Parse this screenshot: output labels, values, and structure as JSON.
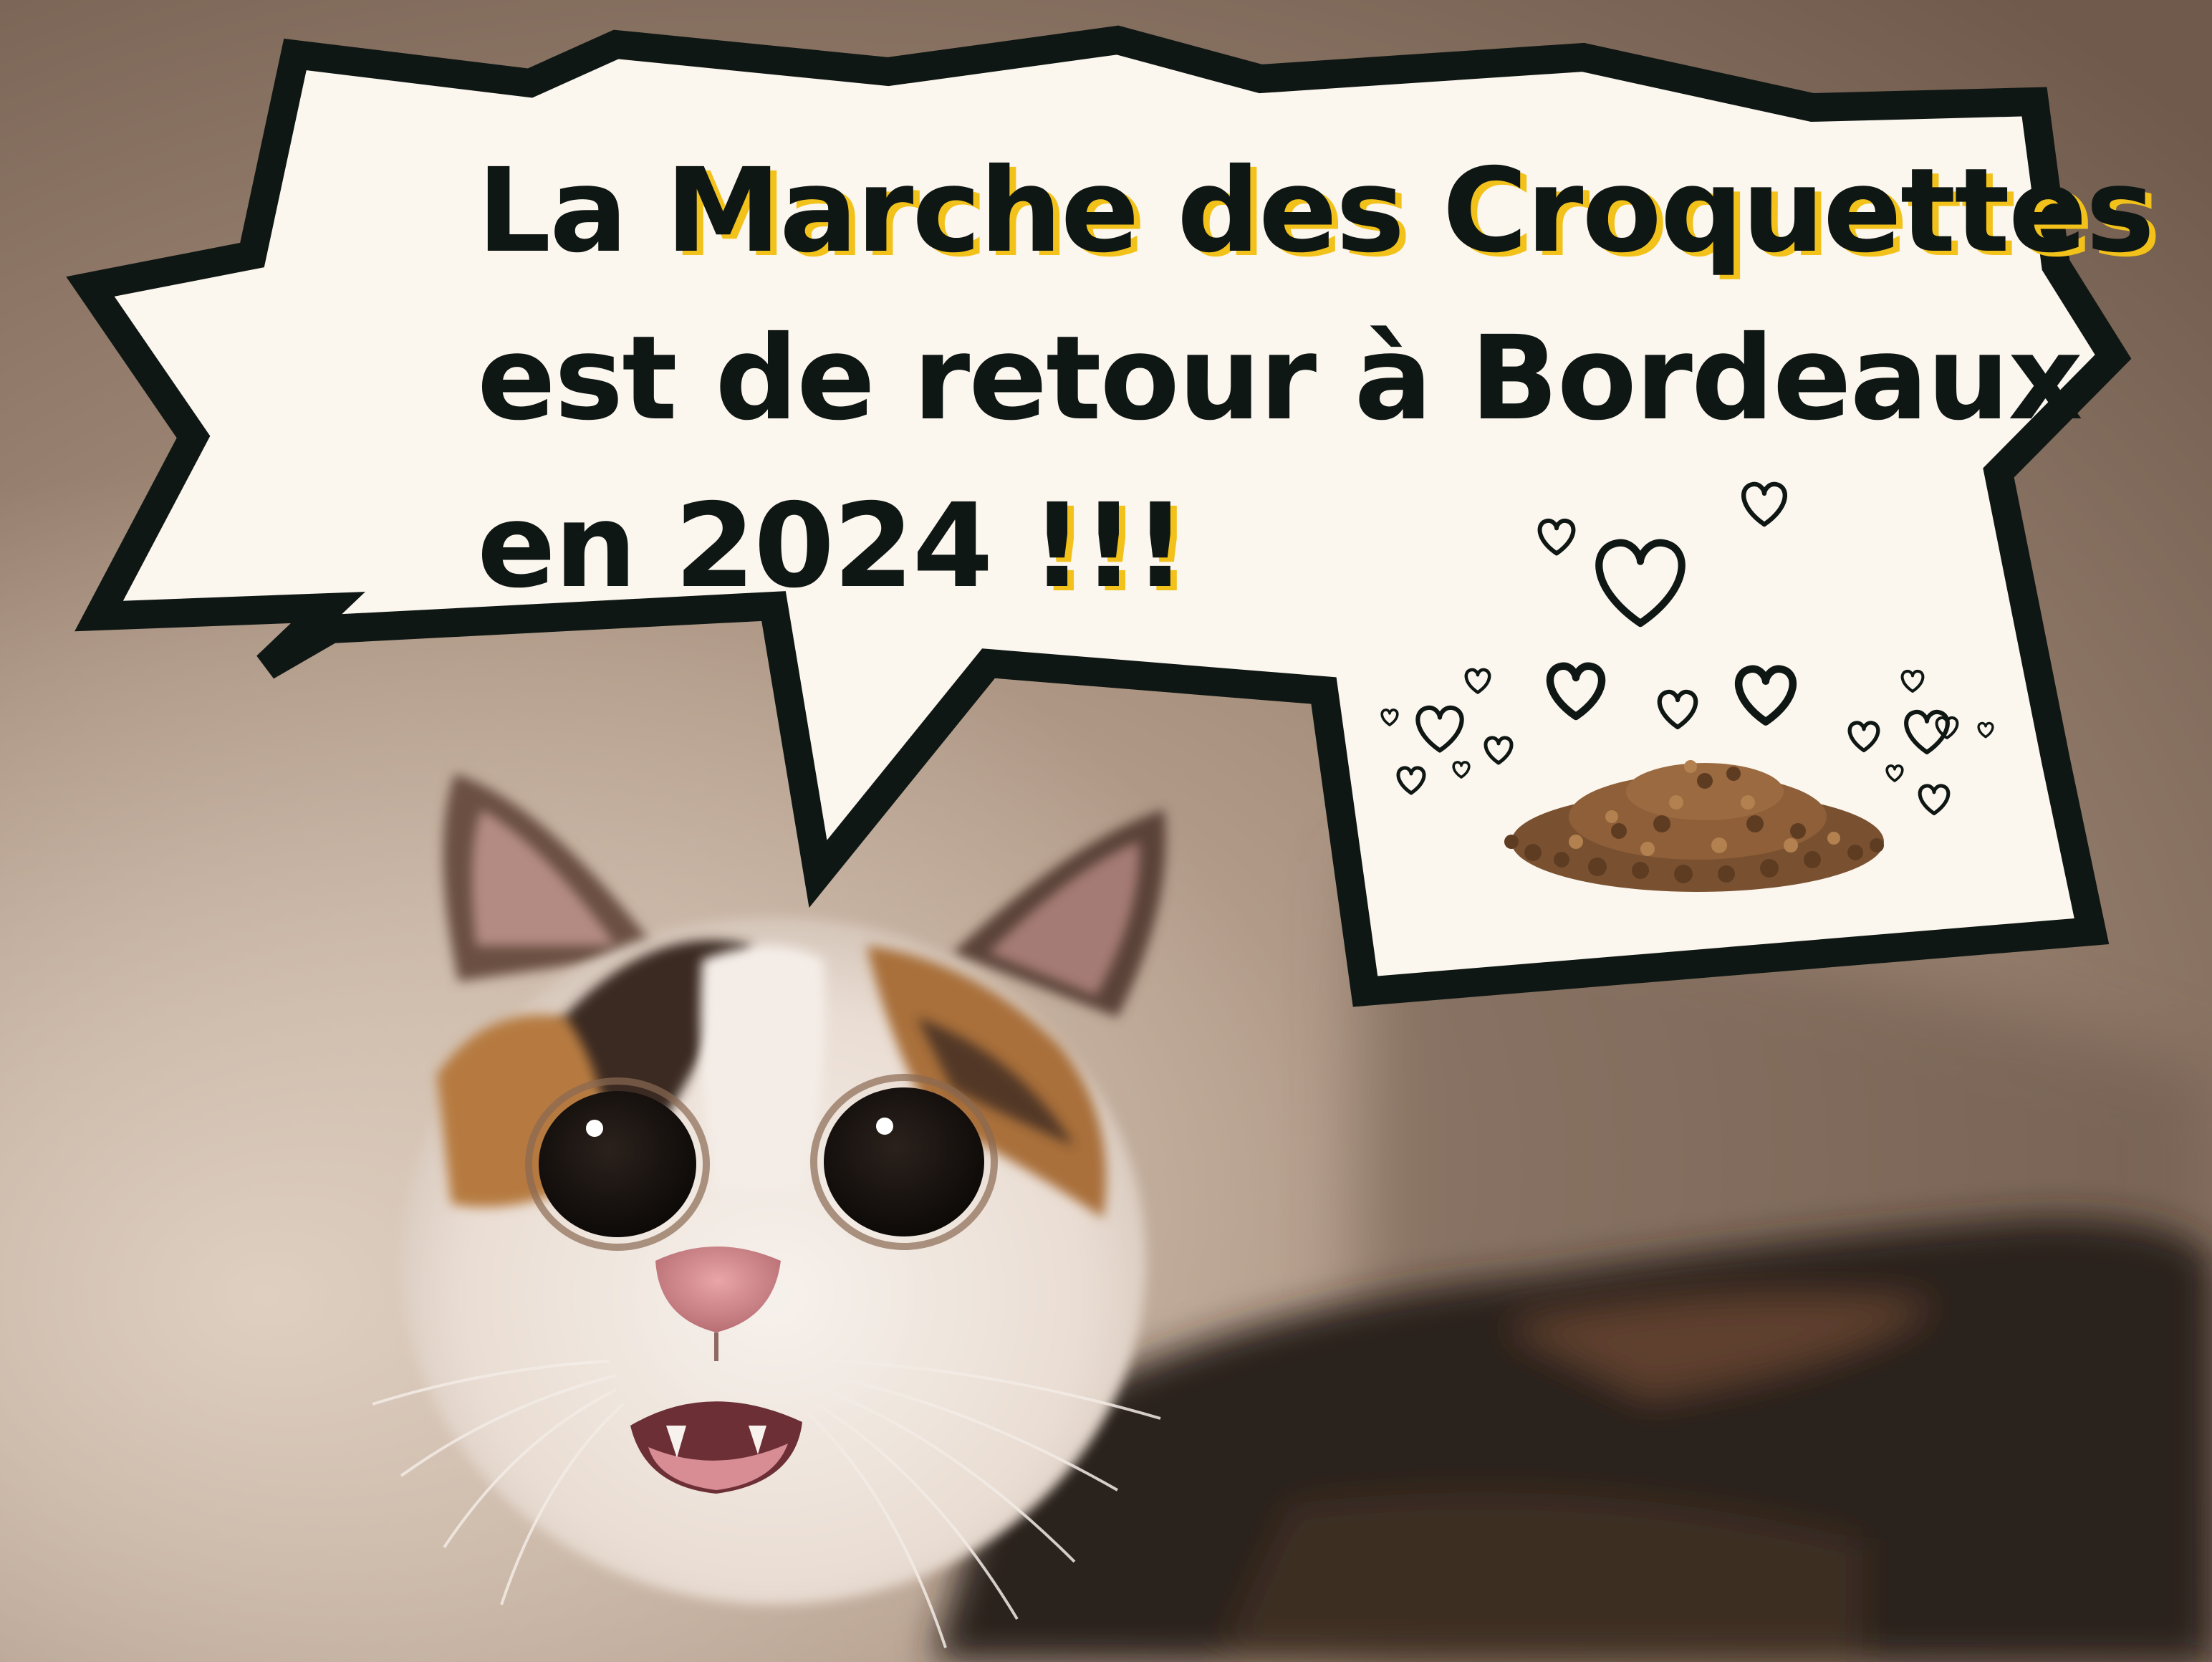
{
  "poster": {
    "line1_prefix": "La ",
    "line1_highlight": "Marche des Croquettes",
    "line2": "est de retour à Bordeaux",
    "line3_prefix": "en 2024 ",
    "line3_highlight": "!!!"
  },
  "colors": {
    "background": "#7d685a",
    "bubble_fill": "#fbf6ee",
    "bubble_outline": "#0f1714",
    "text": "#0f1714",
    "highlight": "#f2c21a"
  }
}
